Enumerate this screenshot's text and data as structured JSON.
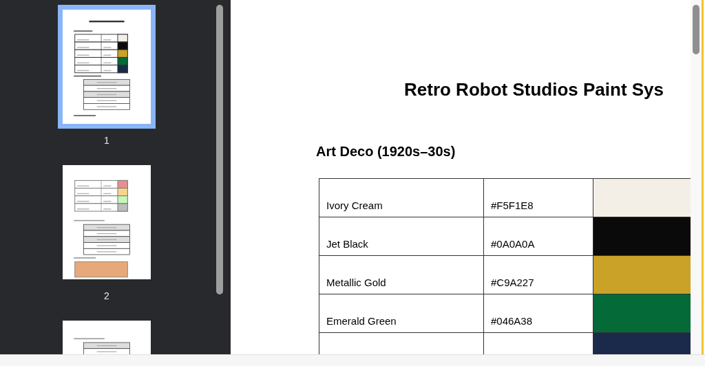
{
  "thumbnails": [
    {
      "label": "1",
      "selected": true
    },
    {
      "label": "2",
      "selected": false
    },
    {
      "selected": false
    }
  ],
  "document": {
    "title": "Retro Robot Studios Paint Sys",
    "section": "Art Deco (1920s–30s)",
    "rows": [
      {
        "name": "Ivory Cream",
        "hex": "#F5F1E8",
        "color": "#f3efe7"
      },
      {
        "name": "Jet Black",
        "hex": "#0A0A0A",
        "color": "#0a0a0a"
      },
      {
        "name": "Metallic Gold",
        "hex": "#C9A227",
        "color": "#c9a227"
      },
      {
        "name": "Emerald Green",
        "hex": "#046A38",
        "color": "#046a38"
      },
      {
        "color": "#1b2a4a"
      }
    ]
  }
}
